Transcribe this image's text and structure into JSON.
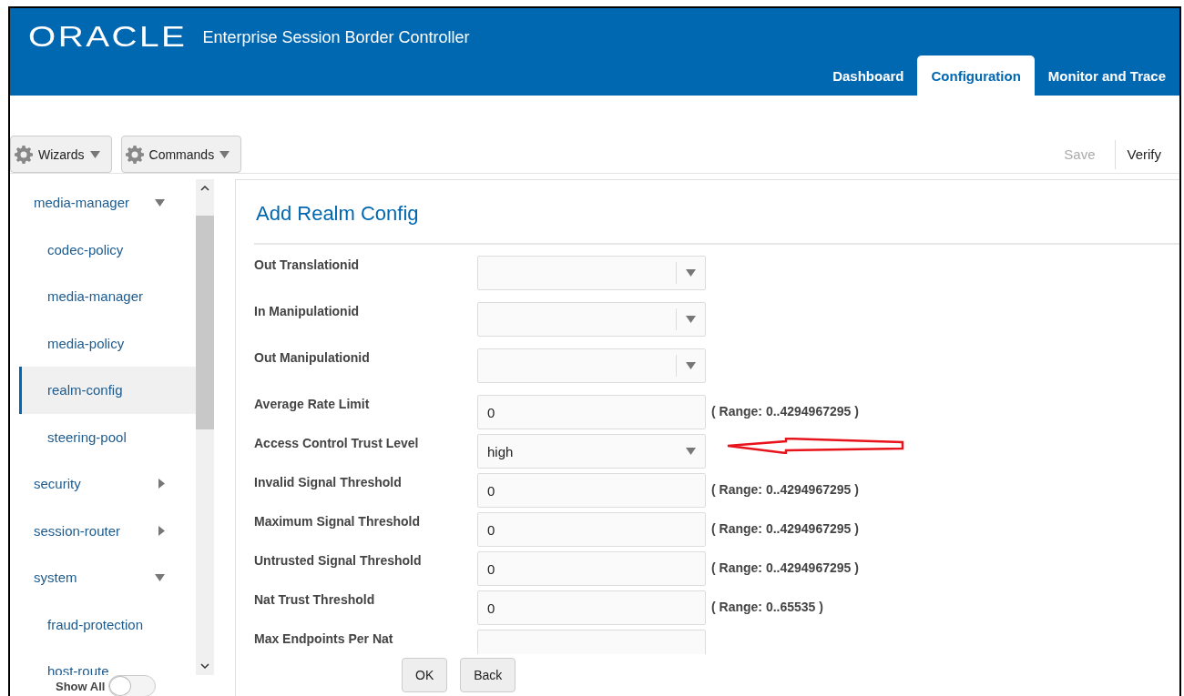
{
  "header": {
    "logo": "ORACLE",
    "product": "Enterprise Session Border Controller"
  },
  "tabs": [
    {
      "label": "Dashboard",
      "selected": false
    },
    {
      "label": "Configuration",
      "selected": true
    },
    {
      "label": "Monitor and Trace",
      "selected": false
    }
  ],
  "toolbar": {
    "menus": [
      {
        "label": "Wizards"
      },
      {
        "label": "Commands"
      }
    ],
    "actions": [
      {
        "label": "Save",
        "disabled": true
      },
      {
        "label": "Verify",
        "disabled": false
      }
    ]
  },
  "sidebar": {
    "items": [
      {
        "label": "media-manager",
        "expanded": true,
        "selected": false,
        "children": [
          {
            "label": "codec-policy",
            "selected": false
          },
          {
            "label": "media-manager",
            "selected": false
          },
          {
            "label": "media-policy",
            "selected": false
          },
          {
            "label": "realm-config",
            "selected": true
          },
          {
            "label": "steering-pool",
            "selected": false
          }
        ]
      },
      {
        "label": "security",
        "expanded": false,
        "selected": false
      },
      {
        "label": "session-router",
        "expanded": false,
        "selected": false
      },
      {
        "label": "system",
        "expanded": true,
        "selected": false,
        "children": [
          {
            "label": "fraud-protection",
            "selected": false
          },
          {
            "label": "host-route",
            "selected": false
          }
        ]
      }
    ],
    "show_all": {
      "label": "Show All",
      "on": false
    }
  },
  "form": {
    "title": "Add Realm Config",
    "fields": [
      {
        "label": "Out Translationid",
        "kind": "select"
      },
      {
        "label": "In Manipulationid",
        "kind": "select"
      },
      {
        "label": "Out Manipulationid",
        "kind": "select"
      },
      {
        "label": "Average Rate Limit",
        "kind": "text",
        "value": "0",
        "range": "( Range: 0..4294967295 )"
      },
      {
        "label": "Access Control Trust Level",
        "kind": "dropdown",
        "value": "high"
      },
      {
        "label": "Invalid Signal Threshold",
        "kind": "text",
        "value": "0",
        "range": "( Range: 0..4294967295 )"
      },
      {
        "label": "Maximum Signal Threshold",
        "kind": "text",
        "value": "0",
        "range": "( Range: 0..4294967295 )"
      },
      {
        "label": "Untrusted Signal Threshold",
        "kind": "text",
        "value": "0",
        "range": "( Range: 0..4294967295 )"
      },
      {
        "label": "Nat Trust Threshold",
        "kind": "text",
        "value": "0",
        "range": "( Range: 0..65535 )"
      },
      {
        "label": "Max Endpoints Per Nat",
        "kind": "text"
      }
    ],
    "buttons": [
      {
        "label": "OK"
      },
      {
        "label": "Back"
      }
    ]
  }
}
